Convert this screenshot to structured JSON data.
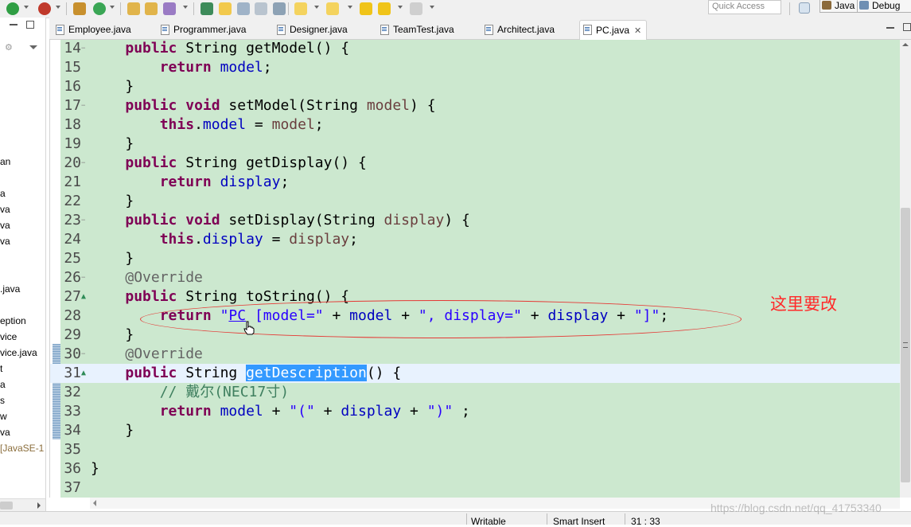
{
  "toolbar": {
    "quick_access_placeholder": "Quick Access",
    "perspectives": [
      "Java",
      "Debug"
    ]
  },
  "package_explorer": {
    "items": [
      "an",
      "a",
      "va",
      "va",
      "va",
      ".java",
      "eption",
      "vice",
      "vice.java",
      "t",
      "a",
      "s",
      "w",
      "va",
      "[JavaSE-1"
    ]
  },
  "editor": {
    "tabs": [
      {
        "label": "Employee.java",
        "active": false
      },
      {
        "label": "Programmer.java",
        "active": false
      },
      {
        "label": "Designer.java",
        "active": false
      },
      {
        "label": "TeamTest.java",
        "active": false
      },
      {
        "label": "Architect.java",
        "active": false
      },
      {
        "label": "PC.java",
        "active": true
      }
    ],
    "lines": [
      {
        "num": "14",
        "fold": "−",
        "tokens": [
          [
            "",
            "    "
          ],
          [
            "kw",
            "public"
          ],
          [
            "",
            " String getModel() {"
          ]
        ]
      },
      {
        "num": "15",
        "fold": "",
        "tokens": [
          [
            "",
            "        "
          ],
          [
            "kw",
            "return"
          ],
          [
            "",
            " "
          ],
          [
            "fld",
            "model"
          ],
          [
            "",
            ";"
          ]
        ]
      },
      {
        "num": "16",
        "fold": "",
        "tokens": [
          [
            "",
            "    }"
          ]
        ]
      },
      {
        "num": "17",
        "fold": "−",
        "tokens": [
          [
            "",
            "    "
          ],
          [
            "kw",
            "public"
          ],
          [
            "",
            " "
          ],
          [
            "kw",
            "void"
          ],
          [
            "",
            " setModel(String "
          ],
          [
            "lvar",
            "model"
          ],
          [
            "",
            ") {"
          ]
        ]
      },
      {
        "num": "18",
        "fold": "",
        "tokens": [
          [
            "",
            "        "
          ],
          [
            "kw",
            "this"
          ],
          [
            "",
            "."
          ],
          [
            "fld",
            "model"
          ],
          [
            "",
            " = "
          ],
          [
            "lvar",
            "model"
          ],
          [
            "",
            ";"
          ]
        ]
      },
      {
        "num": "19",
        "fold": "",
        "tokens": [
          [
            "",
            "    }"
          ]
        ]
      },
      {
        "num": "20",
        "fold": "−",
        "tokens": [
          [
            "",
            "    "
          ],
          [
            "kw",
            "public"
          ],
          [
            "",
            " String getDisplay() {"
          ]
        ]
      },
      {
        "num": "21",
        "fold": "",
        "tokens": [
          [
            "",
            "        "
          ],
          [
            "kw",
            "return"
          ],
          [
            "",
            " "
          ],
          [
            "fld",
            "display"
          ],
          [
            "",
            ";"
          ]
        ]
      },
      {
        "num": "22",
        "fold": "",
        "tokens": [
          [
            "",
            "    }"
          ]
        ]
      },
      {
        "num": "23",
        "fold": "−",
        "tokens": [
          [
            "",
            "    "
          ],
          [
            "kw",
            "public"
          ],
          [
            "",
            " "
          ],
          [
            "kw",
            "void"
          ],
          [
            "",
            " setDisplay(String "
          ],
          [
            "lvar",
            "display"
          ],
          [
            "",
            ") {"
          ]
        ]
      },
      {
        "num": "24",
        "fold": "",
        "tokens": [
          [
            "",
            "        "
          ],
          [
            "kw",
            "this"
          ],
          [
            "",
            "."
          ],
          [
            "fld",
            "display"
          ],
          [
            "",
            " = "
          ],
          [
            "lvar",
            "display"
          ],
          [
            "",
            ";"
          ]
        ]
      },
      {
        "num": "25",
        "fold": "",
        "tokens": [
          [
            "",
            "    }"
          ]
        ]
      },
      {
        "num": "26",
        "fold": "−",
        "tokens": [
          [
            "",
            "    "
          ],
          [
            "ann",
            "@Override"
          ]
        ]
      },
      {
        "num": "27",
        "fold": "▲",
        "tokens": [
          [
            "",
            "    "
          ],
          [
            "kw",
            "public"
          ],
          [
            "",
            " String toString() {"
          ]
        ]
      },
      {
        "num": "28",
        "fold": "",
        "tokens": [
          [
            "",
            "        "
          ],
          [
            "kw",
            "return"
          ],
          [
            "",
            " "
          ],
          [
            "str",
            "\""
          ],
          [
            "link",
            "PC"
          ],
          [
            "str",
            " [model=\""
          ],
          [
            "",
            " + "
          ],
          [
            "fld",
            "model"
          ],
          [
            "",
            " + "
          ],
          [
            "str",
            "\", display=\""
          ],
          [
            "",
            " + "
          ],
          [
            "fld",
            "display"
          ],
          [
            "",
            " + "
          ],
          [
            "str",
            "\"]\""
          ],
          [
            "",
            ";"
          ]
        ]
      },
      {
        "num": "29",
        "fold": "",
        "tokens": [
          [
            "",
            "    }"
          ]
        ]
      },
      {
        "num": "30",
        "fold": "−",
        "tokens": [
          [
            "",
            "    "
          ],
          [
            "ann",
            "@Override"
          ]
        ]
      },
      {
        "num": "31",
        "fold": "▲",
        "current": true,
        "tokens": [
          [
            "",
            "    "
          ],
          [
            "kw",
            "public"
          ],
          [
            "",
            " String "
          ],
          [
            "sel",
            "getDescription"
          ],
          [
            "",
            "() {"
          ]
        ]
      },
      {
        "num": "32",
        "fold": "",
        "tokens": [
          [
            "",
            "        "
          ],
          [
            "cmt",
            "// 戴尔(NEC17寸)"
          ]
        ]
      },
      {
        "num": "33",
        "fold": "",
        "tokens": [
          [
            "",
            "        "
          ],
          [
            "kw",
            "return"
          ],
          [
            "",
            " "
          ],
          [
            "fld",
            "model"
          ],
          [
            "",
            " + "
          ],
          [
            "str",
            "\"(\""
          ],
          [
            "",
            " + "
          ],
          [
            "fld",
            "display"
          ],
          [
            "",
            " + "
          ],
          [
            "str",
            "\")\""
          ],
          [
            "",
            " ;"
          ]
        ]
      },
      {
        "num": "34",
        "fold": "",
        "tokens": [
          [
            "",
            "    }"
          ]
        ]
      },
      {
        "num": "35",
        "fold": "",
        "tokens": [
          [
            "",
            ""
          ]
        ]
      },
      {
        "num": "36",
        "fold": "",
        "tokens": [
          [
            "",
            "}"
          ]
        ]
      },
      {
        "num": "37",
        "fold": "",
        "tokens": [
          [
            "",
            ""
          ]
        ]
      }
    ]
  },
  "annotation": {
    "callout_text": "这里要改",
    "color": "#ff2a2a"
  },
  "statusbar": {
    "writable": "Writable",
    "insert_mode": "Smart Insert",
    "position": "31 : 33"
  },
  "watermark": "https://blog.csdn.net/qq_41753340"
}
